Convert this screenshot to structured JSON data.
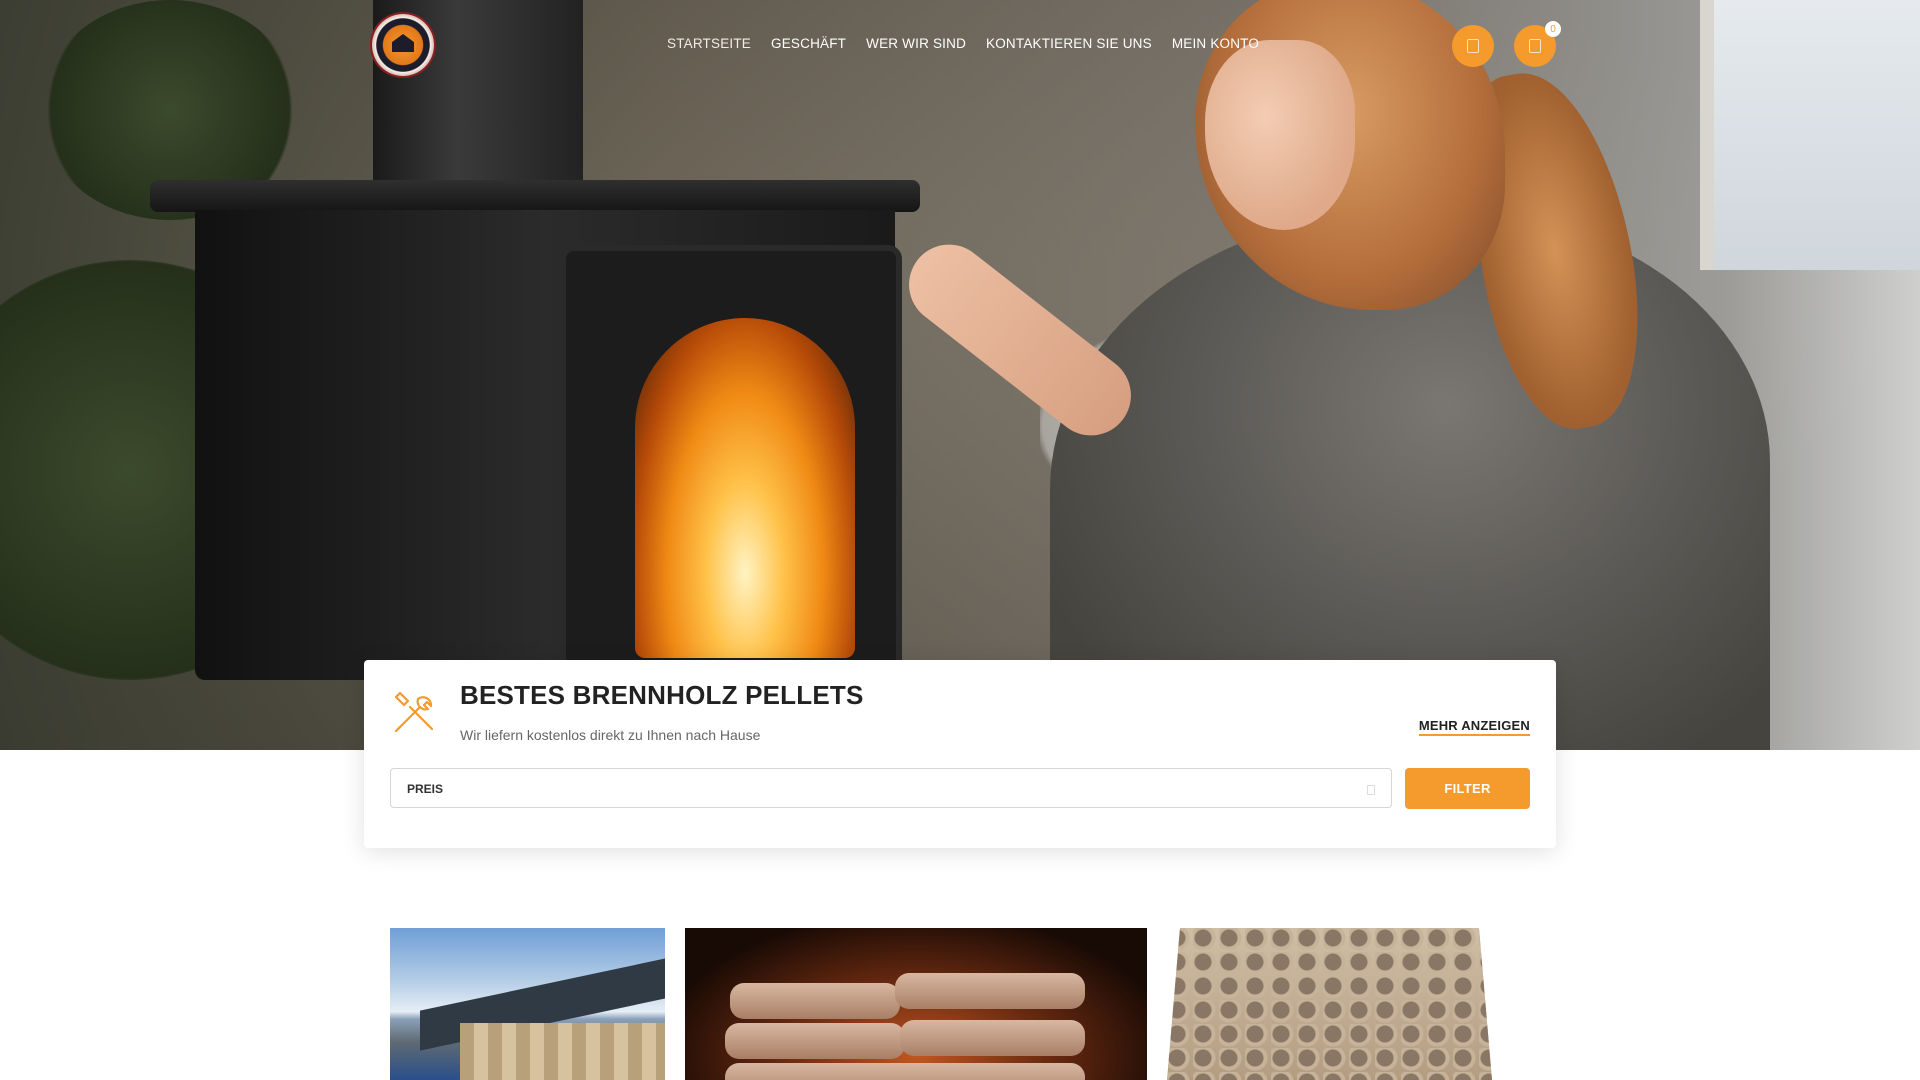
{
  "nav": {
    "logo_alt": "Wink und Wärme",
    "items": [
      {
        "label": "STARTSEITE",
        "active": true
      },
      {
        "label": "GESCHÄFT",
        "active": false
      },
      {
        "label": "WER WIR SIND",
        "active": false
      },
      {
        "label": "KONTAKTIEREN SIE UNS",
        "active": false
      },
      {
        "label": "MEIN KONTO",
        "active": false
      }
    ],
    "search_icon": "search-icon",
    "cart_icon": "cart-icon",
    "cart_count": "0"
  },
  "filter_card": {
    "title": "BESTES BRENNHOLZ PELLETS",
    "subtitle": "Wir liefern kostenlos direkt zu Ihnen nach Hause",
    "more_link": "MEHR ANZEIGEN",
    "select_label": "PREIS",
    "filter_button": "FILTER",
    "icon": "tools-icon"
  },
  "colors": {
    "accent": "#f59a2c",
    "text_dark": "#222222",
    "text_muted": "#666666"
  },
  "products": [
    {
      "image": "warehouse-photo"
    },
    {
      "image": "pellet-bags-photo"
    },
    {
      "image": "wood-briquettes-photo"
    }
  ]
}
